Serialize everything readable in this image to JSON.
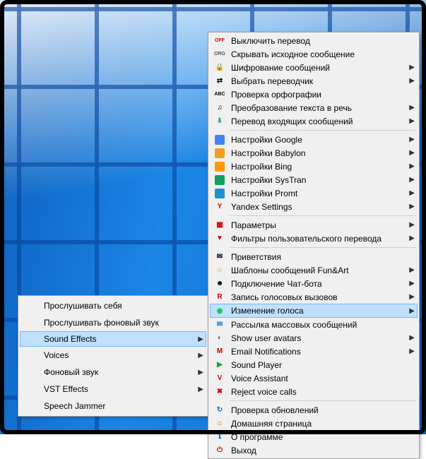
{
  "leftMenu": {
    "highlightedIndex": 2,
    "items": [
      {
        "label": "Прослушивать себя",
        "icon": "listen-self-icon",
        "sub": false
      },
      {
        "label": "Прослушивать фоновый звук",
        "icon": "listen-bg-icon",
        "sub": false
      },
      {
        "label": "Sound Effects",
        "icon": "sound-effects-icon",
        "sub": true
      },
      {
        "label": "Voices",
        "icon": "voices-icon",
        "sub": true
      },
      {
        "label": "Фоновый звук",
        "icon": "bg-sound-icon",
        "sub": true
      },
      {
        "label": "VST Effects",
        "icon": "vst-effects-icon",
        "sub": true
      },
      {
        "label": "Speech Jammer",
        "icon": "speech-jammer-icon",
        "sub": false
      }
    ]
  },
  "rightMenu": {
    "highlightedIndex": 19,
    "groups": [
      [
        {
          "label": "Выключить перевод",
          "icon": "off-icon",
          "sub": false,
          "glyph": "OFF",
          "color": "#d60000"
        },
        {
          "label": "Скрывать исходное сообщение",
          "icon": "org-icon",
          "sub": false,
          "glyph": "ORG",
          "color": "#555"
        },
        {
          "label": "Шифрование сообщений",
          "icon": "encrypt-icon",
          "sub": true,
          "glyph": "🔒",
          "color": "#b08000"
        },
        {
          "label": "Выбрать переводчик",
          "icon": "switch-icon",
          "sub": true,
          "glyph": "⇄",
          "color": "#000"
        },
        {
          "label": "Проверка орфографии",
          "icon": "spell-icon",
          "sub": false,
          "glyph": "ABC",
          "color": "#000"
        },
        {
          "label": "Преобразование текста в речь",
          "icon": "tts-icon",
          "sub": true,
          "glyph": "♫",
          "color": "#000"
        },
        {
          "label": "Перевод входящих сообщений",
          "icon": "incoming-icon",
          "sub": true,
          "glyph": "⬇",
          "color": "#2a8"
        }
      ],
      [
        {
          "label": "Настройки Google",
          "icon": "google-icon",
          "sub": true,
          "bg": "#4285f4"
        },
        {
          "label": "Настройки Babylon",
          "icon": "babylon-icon",
          "sub": true,
          "bg": "#f0a020"
        },
        {
          "label": "Настройки Bing",
          "icon": "bing-icon",
          "sub": true,
          "bg": "#ff9900"
        },
        {
          "label": "Настройки SysTran",
          "icon": "systran-icon",
          "sub": true,
          "bg": "#10a060"
        },
        {
          "label": "Настройки Promt",
          "icon": "promt-icon",
          "sub": true,
          "bg": "#2090d0"
        },
        {
          "label": "Yandex Settings",
          "icon": "yandex-icon",
          "sub": true,
          "glyph": "Y",
          "color": "#d00000"
        }
      ],
      [
        {
          "label": "Параметры",
          "icon": "params-icon",
          "sub": true,
          "glyph": "▦",
          "color": "#d00000"
        },
        {
          "label": "Фильтры пользовательского перевода",
          "icon": "filters-icon",
          "sub": true,
          "glyph": "▼",
          "color": "#d00000"
        }
      ],
      [
        {
          "label": "Приветствия",
          "icon": "greetings-icon",
          "sub": false,
          "glyph": "✉",
          "color": "#000"
        },
        {
          "label": "Шаблоны сообщений Fun&Art",
          "icon": "funart-icon",
          "sub": true,
          "glyph": "☺",
          "color": "#e0a000"
        },
        {
          "label": "Подключение Чат-бота",
          "icon": "chatbot-icon",
          "sub": true,
          "glyph": "☻",
          "color": "#000"
        },
        {
          "label": "Запись голосовых вызовов",
          "icon": "record-icon",
          "sub": true,
          "glyph": "R",
          "color": "#d00000"
        },
        {
          "label": "Изменение голоса",
          "icon": "voicechg-icon",
          "sub": true,
          "glyph": "◉",
          "color": "#10c040"
        },
        {
          "label": "Рассылка массовых сообщений",
          "icon": "massmsg-icon",
          "sub": false,
          "glyph": "✉",
          "color": "#0080d0"
        },
        {
          "label": "Show user avatars",
          "icon": "avatars-icon",
          "sub": true,
          "glyph": "◐",
          "color": "#666"
        },
        {
          "label": "Email Notifications",
          "icon": "email-icon",
          "sub": true,
          "glyph": "M",
          "color": "#d00000"
        },
        {
          "label": "Sound Player",
          "icon": "player-icon",
          "sub": false,
          "glyph": "▶",
          "color": "#10a040"
        },
        {
          "label": "   Voice Assistant",
          "icon": "voiceasst-icon",
          "sub": false,
          "glyph": "V",
          "color": "#d00000"
        },
        {
          "label": "   Reject voice calls",
          "icon": "reject-icon",
          "sub": false,
          "glyph": "✖",
          "color": "#d00000"
        }
      ],
      [
        {
          "label": "Проверка обновлений",
          "icon": "update-icon",
          "sub": false,
          "glyph": "↻",
          "color": "#0070d0"
        },
        {
          "label": "Домашняя страница",
          "icon": "home-icon",
          "sub": false,
          "glyph": "⌂",
          "color": "#b07000"
        },
        {
          "label": "О программе",
          "icon": "about-icon",
          "sub": false,
          "glyph": "ℹ",
          "color": "#0070d0"
        },
        {
          "label": "Выход",
          "icon": "exit-icon",
          "sub": false,
          "glyph": "⏻",
          "color": "#d00000"
        }
      ]
    ]
  }
}
